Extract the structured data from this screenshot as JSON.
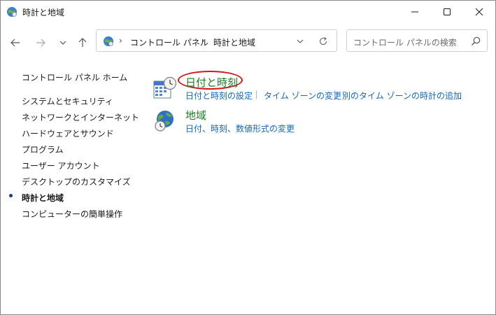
{
  "window": {
    "title": "時計と地域",
    "minimize_icon": "minimize-icon",
    "maximize_icon": "maximize-icon",
    "close_icon": "close-icon"
  },
  "nav": {
    "back_icon": "arrow-left-icon",
    "forward_icon": "arrow-right-icon",
    "recent_icon": "chevron-down-icon",
    "up_icon": "arrow-up-icon"
  },
  "address": {
    "segments": [
      "コントロール パネル",
      "時計と地域"
    ],
    "separator": "›"
  },
  "search": {
    "placeholder": "コントロール パネルの検索"
  },
  "sidebar": {
    "home": "コントロール パネル ホーム",
    "items": [
      {
        "label": "システムとセキュリティ",
        "active": false
      },
      {
        "label": "ネットワークとインターネット",
        "active": false
      },
      {
        "label": "ハードウェアとサウンド",
        "active": false
      },
      {
        "label": "プログラム",
        "active": false
      },
      {
        "label": "ユーザー アカウント",
        "active": false
      },
      {
        "label": "デスクトップのカスタマイズ",
        "active": false
      },
      {
        "label": "時計と地域",
        "active": true
      },
      {
        "label": "コンピューターの簡単操作",
        "active": false
      }
    ]
  },
  "categories": [
    {
      "title": "日付と時刻",
      "icon": "date-time-icon",
      "links": [
        "日付と時刻の設定",
        "タイム ゾーンの変更",
        "別のタイム ゾーンの時計の追加"
      ]
    },
    {
      "title": "地域",
      "icon": "region-globe-icon",
      "links": [
        "日付、時刻、数値形式の変更"
      ]
    }
  ],
  "colors": {
    "category_title": "#1e7b26",
    "link": "#1466b8",
    "highlight": "#d01818"
  }
}
